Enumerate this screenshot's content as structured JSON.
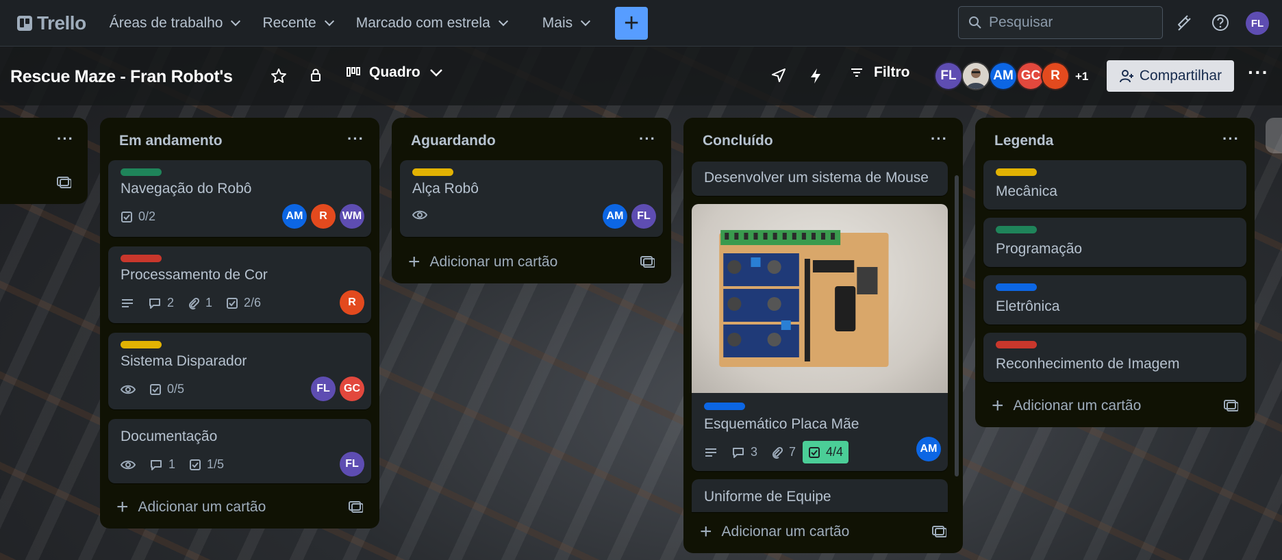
{
  "colors": {
    "green": "#1f845a",
    "red": "#c9372c",
    "yellow": "#e2b203",
    "blue": "#0c66e4",
    "accent": "#579dff",
    "done_badge": "#4bce97"
  },
  "topnav": {
    "logo": "Trello",
    "menus": [
      "Áreas de trabalho",
      "Recente",
      "Marcado com estrela",
      "Mais"
    ],
    "search_placeholder": "Pesquisar",
    "user_initials": "FL"
  },
  "board": {
    "title": "Rescue Maze - Fran Robot's",
    "view_label": "Quadro",
    "filter_label": "Filtro",
    "members": [
      {
        "initials": "FL",
        "color": "#5e4db2"
      },
      {
        "initials": "",
        "color": "#c8c2b9"
      },
      {
        "initials": "AM",
        "color": "#0c66e4"
      },
      {
        "initials": "GC",
        "color": "#e2483d"
      },
      {
        "initials": "R",
        "color": "#e34a1e"
      }
    ],
    "more_members": "+1",
    "share_label": "Compartilhar"
  },
  "lists": {
    "add_card_label": "Adicionar um cartão",
    "em_andamento": {
      "title": "Em andamento",
      "cards": [
        {
          "title": "Navegação do Robô",
          "checklist": "0/2",
          "members": [
            "AM",
            "R",
            "WM"
          ]
        },
        {
          "title": "Processamento de Cor",
          "comments": "2",
          "attachments": "1",
          "checklist": "2/6",
          "members": [
            "R"
          ]
        },
        {
          "title": "Sistema Disparador",
          "checklist": "0/5",
          "members": [
            "FL",
            "GC"
          ]
        },
        {
          "title": "Documentação",
          "comments": "1",
          "checklist": "1/5",
          "members": [
            "FL"
          ]
        }
      ]
    },
    "aguardando": {
      "title": "Aguardando",
      "cards": [
        {
          "title": "Alça Robô",
          "members": [
            "AM",
            "FL"
          ]
        }
      ]
    },
    "concluido": {
      "title": "Concluído",
      "cards": [
        {
          "title": "Desenvolver um sistema de Mouse"
        },
        {
          "title": "Esquemático Placa Mãe",
          "comments": "3",
          "attachments": "7",
          "checklist": "4/4",
          "members": [
            "AM"
          ]
        },
        {
          "title": "Uniforme de Equipe"
        }
      ]
    },
    "legenda": {
      "title": "Legenda",
      "cards": [
        {
          "title": "Mecânica"
        },
        {
          "title": "Programação"
        },
        {
          "title": "Eletrônica"
        },
        {
          "title": "Reconhecimento de Imagem"
        }
      ]
    }
  }
}
